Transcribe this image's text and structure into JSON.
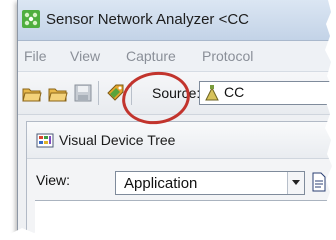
{
  "window": {
    "title": "Sensor Network Analyzer <CC"
  },
  "menu": {
    "items": [
      "File",
      "View",
      "Capture",
      "Protocol"
    ]
  },
  "toolbar": {
    "source_label": "Source:",
    "source_value": "CC"
  },
  "panel": {
    "title": "Visual Device Tree",
    "view_label": "View:",
    "view_value": "Application"
  },
  "colors": {
    "highlight_circle": "#c2342d",
    "titlebar": "#c3d3e7"
  }
}
